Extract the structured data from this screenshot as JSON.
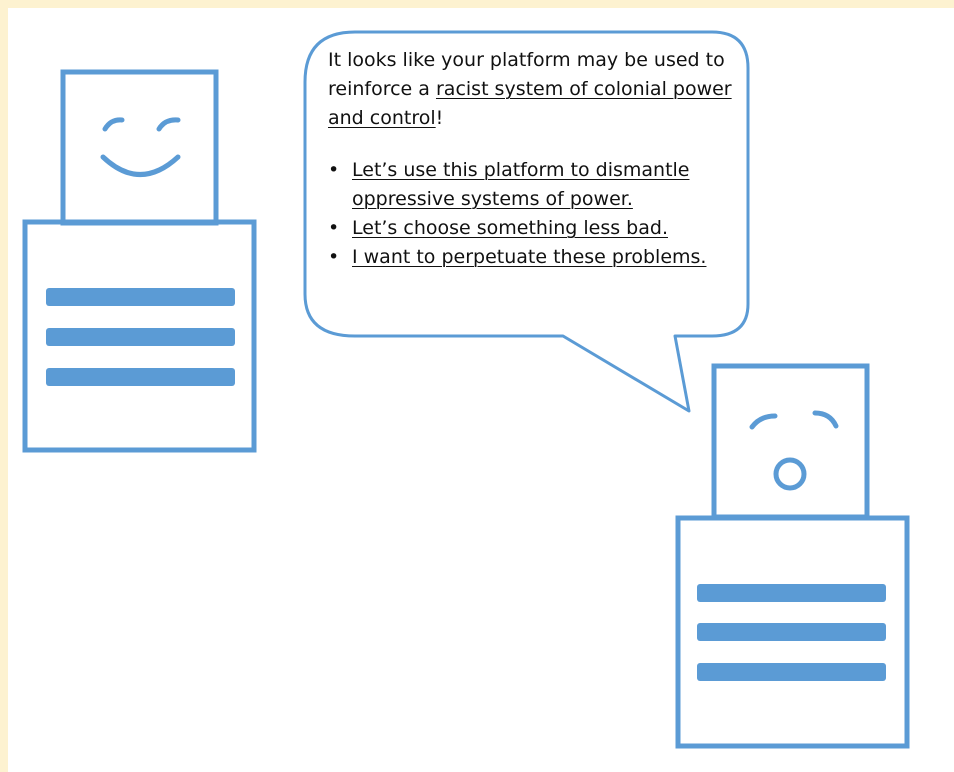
{
  "colors": {
    "stroke": "#5b9bd5",
    "background": "#fdf2d0",
    "canvas": "#ffffff",
    "text": "#111111"
  },
  "speech_bubble": {
    "intro": {
      "before": "It looks like your platform may be used to reinforce a ",
      "link": "racist system of colonial power and control",
      "after": "!"
    },
    "bullet_glyph": "•",
    "options": [
      {
        "label": "Let’s use this platform to dismantle oppressive systems of power."
      },
      {
        "label": "Let’s choose something less bad."
      },
      {
        "label": "I want to perpetuate these problems."
      }
    ]
  },
  "characters": [
    {
      "name": "assistant-robot",
      "expression": "smiling"
    },
    {
      "name": "user-robot",
      "expression": "surprised"
    }
  ]
}
